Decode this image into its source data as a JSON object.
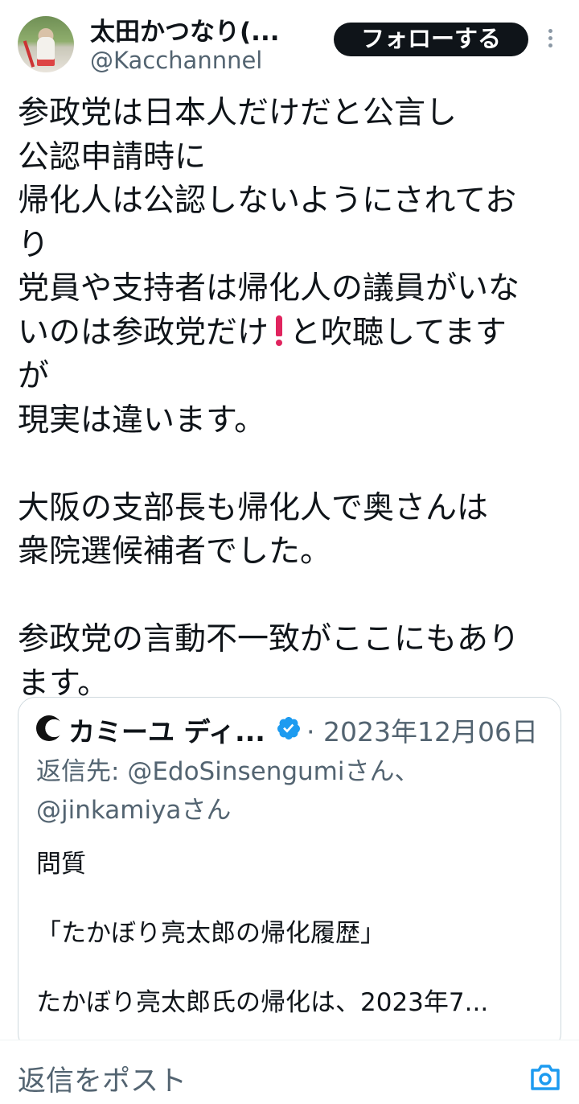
{
  "author": {
    "display_name": "太田かつなり(...",
    "handle": "@Kacchannnel",
    "follow_label": "フォローする"
  },
  "tweet": {
    "lines": [
      "参政党は日本人だけだと公言し",
      "公認申請時に",
      "帰化人は公認しないようにされてお",
      "り",
      "党員や支持者は帰化人の議員がいな"
    ],
    "line_with_emoji_before": "いのは参政党だけ",
    "line_with_emoji_after": "と吹聴してます",
    "lines_after": [
      "が",
      "現実は違います。"
    ],
    "paragraph2": [
      "大阪の支部長も帰化人で奥さんは",
      "衆院選候補者でした。"
    ],
    "paragraph3": [
      "参政党の言動不一致がここにもあり",
      "ます。"
    ]
  },
  "quote": {
    "name": "カミーユ ディ...",
    "date": "· 2023年12月06日",
    "reply_prefix": "返信先: ",
    "reply_mention1": "@EdoSinsengumiさん、",
    "reply_mention2": "@jinkamiyaさん",
    "body_line1": "問質",
    "body_line2": "「たかぼり亮太郎の帰化履歴」",
    "body_line3": "たかぼり亮太郎氏の帰化は、2023年7..."
  },
  "reply_bar": {
    "placeholder": "返信をポスト"
  },
  "colors": {
    "text": "#0f1419",
    "secondary": "#536471",
    "verified": "#1d9bf0",
    "emoji_red": "#e0245e"
  }
}
